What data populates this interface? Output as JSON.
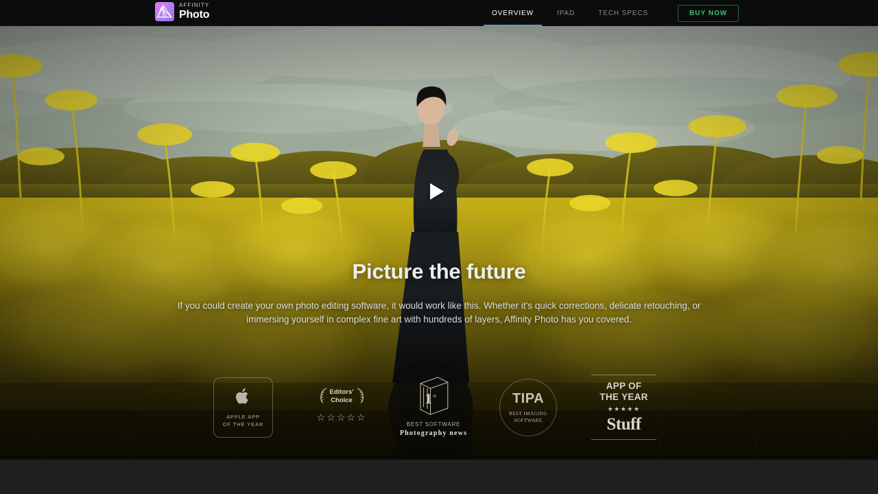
{
  "header": {
    "brand": {
      "icon": "affinity-photo-logo-icon",
      "eyebrow": "AFFINITY",
      "name": "Photo"
    },
    "nav_items": [
      {
        "label": "OVERVIEW",
        "active": true
      },
      {
        "label": "IPAD",
        "active": false
      },
      {
        "label": "TECH SPECS",
        "active": false
      }
    ],
    "buy_button": "BUY NOW",
    "colors": {
      "background": "#0c0c0c",
      "active_underline": "#4a9fe0",
      "buy_text": "#3cbf6e",
      "buy_border": "#1d6b3c",
      "nav_inactive": "#8d8d8d",
      "nav_active": "#ffffff"
    }
  },
  "hero": {
    "media": {
      "type": "video-poster",
      "description": "Woman in a black gown standing in a yellow fennel field under a pale sky",
      "play_button": "play-icon"
    },
    "title": "Picture the future",
    "subtitle": "If you could create your own photo editing software, it would work like this. Whether it's quick corrections, delicate retouching, or immersing yourself in complex fine art with hundreds of layers, Affinity Photo has you covered.",
    "colors": {
      "title": "#eceded",
      "subtitle": "#dcdcdc",
      "field_yellow": "#c9b416",
      "sky": "#aab6ab"
    }
  },
  "awards": [
    {
      "id": "apple-app-of-the-year",
      "icon": "apple-logo-icon",
      "glyph": "",
      "lines": [
        "APPLE APP",
        "OF THE YEAR"
      ]
    },
    {
      "id": "editors-choice",
      "icon": "laurel-wreath-icon",
      "laurel_left": "✿",
      "laurel_right": "✿",
      "lines": [
        "Editors'",
        "Choice"
      ],
      "stars": "☆☆☆☆☆",
      "star_count": 5,
      "stars_filled": false
    },
    {
      "id": "best-software-photography-news",
      "icon": "podium-first-place-icon",
      "caption": "BEST SOFTWARE",
      "publication": "Photography news"
    },
    {
      "id": "tipa-best-imaging-software",
      "icon": "tipa-circle-icon",
      "word": "TIPA",
      "lines": [
        "BEST IMAGING",
        "SOFTWARE"
      ]
    },
    {
      "id": "stuff-app-of-the-year",
      "icon": "stuff-magazine-icon",
      "lines": [
        "APP OF",
        "THE YEAR"
      ],
      "stars": "★★★★★",
      "star_count": 5,
      "stars_filled": true,
      "publication": "Stuff"
    }
  ],
  "page": {
    "background": "#1f2121"
  }
}
